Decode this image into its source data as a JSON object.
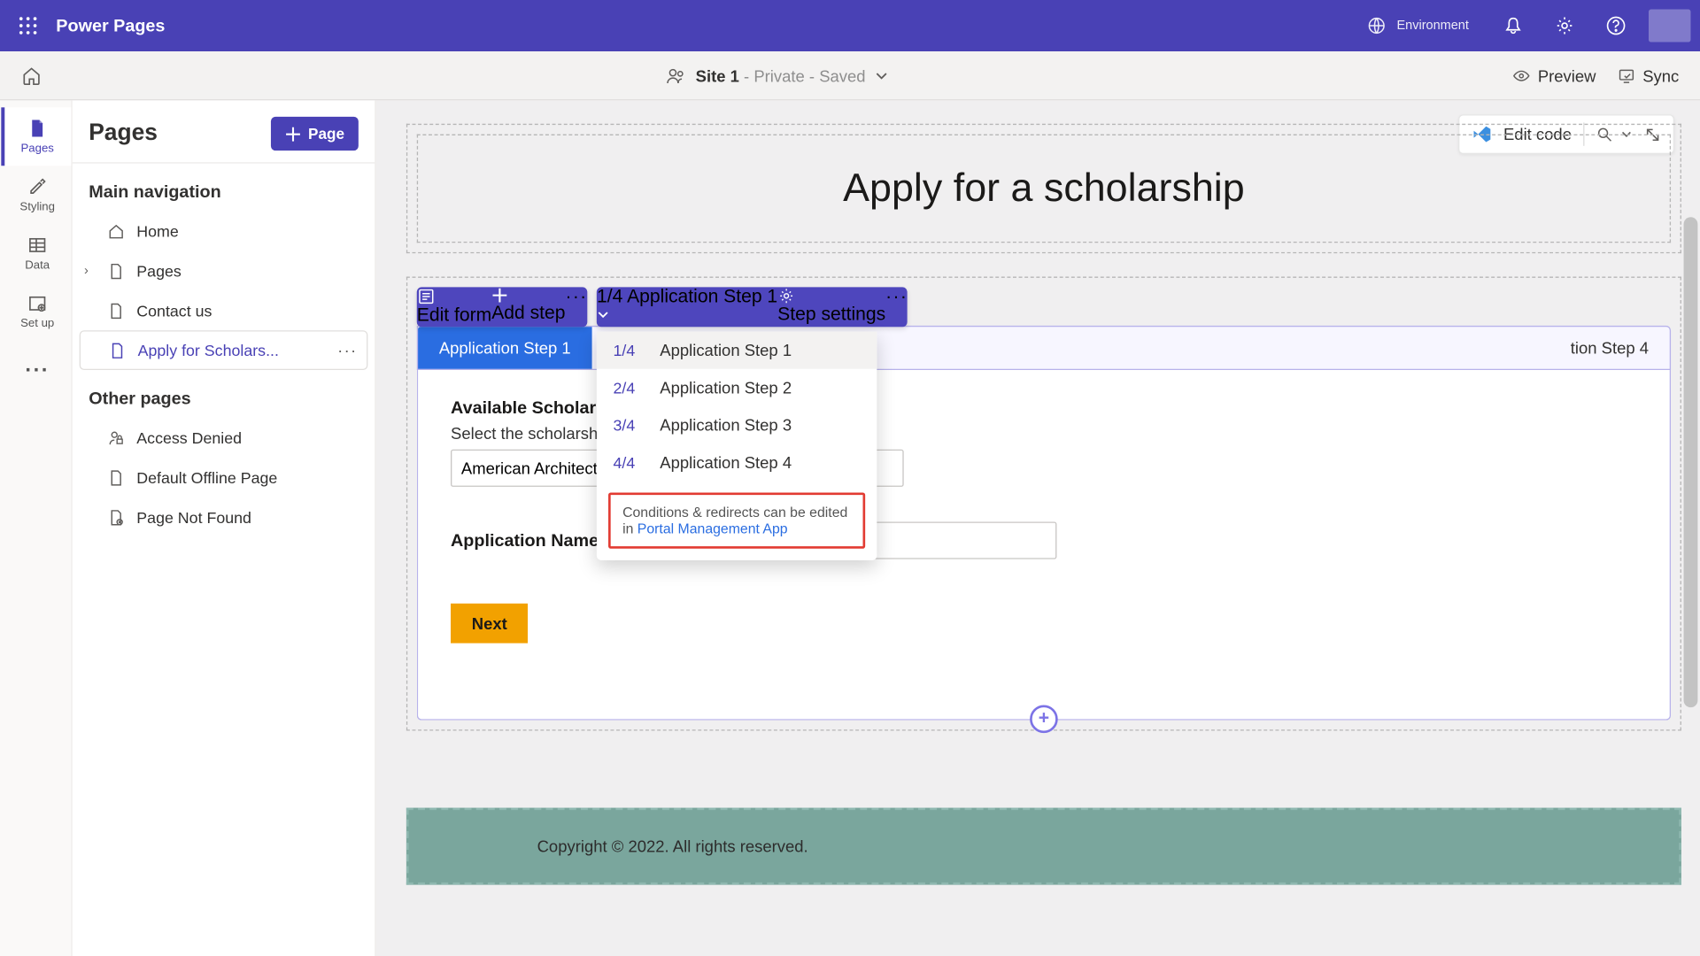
{
  "topbar": {
    "brand": "Power Pages",
    "env_label": "Environment"
  },
  "secbar": {
    "site_name": "Site 1",
    "site_status": " - Private - Saved",
    "preview": "Preview",
    "sync": "Sync"
  },
  "rail": {
    "pages": "Pages",
    "styling": "Styling",
    "data": "Data",
    "setup": "Set up"
  },
  "sidepanel": {
    "title": "Pages",
    "add_page": "Page",
    "main_nav": "Main navigation",
    "other_pages": "Other pages",
    "items_main": {
      "home": "Home",
      "pages": "Pages",
      "contact": "Contact us",
      "apply": "Apply for Scholars..."
    },
    "items_other": {
      "access": "Access Denied",
      "offline": "Default Offline Page",
      "notfound": "Page Not Found"
    }
  },
  "float": {
    "edit_code": "Edit code"
  },
  "hero": {
    "title": "Apply for a scholarship"
  },
  "toolbar": {
    "edit_form": "Edit form",
    "add_step": "Add step",
    "step_indicator": "1/4 Application Step 1",
    "step_settings": "Step settings"
  },
  "tabs": {
    "t1": "Application Step 1",
    "t2": "Application Step 2",
    "t3": "Application Step 3",
    "t4": "Application Step 4",
    "t4_partial": "tion Step 4"
  },
  "dropdown": {
    "i1": "1/4",
    "l1": "Application Step 1",
    "i2": "2/4",
    "l2": "Application Step 2",
    "i3": "3/4",
    "l3": "Application Step 3",
    "i4": "4/4",
    "l4": "Application Step 4",
    "note": "Conditions & redirects can be edited in ",
    "note_link": "Portal Management App"
  },
  "form": {
    "scholarship_label": "Available Scholarships",
    "scholarship_help": "Select the scholarship that you wis",
    "scholarship_value": "American Architect Scholarship",
    "appname_label": "Application Name",
    "appname_value": "",
    "next": "Next"
  },
  "footer": {
    "copy": "Copyright © 2022. All rights reserved."
  }
}
